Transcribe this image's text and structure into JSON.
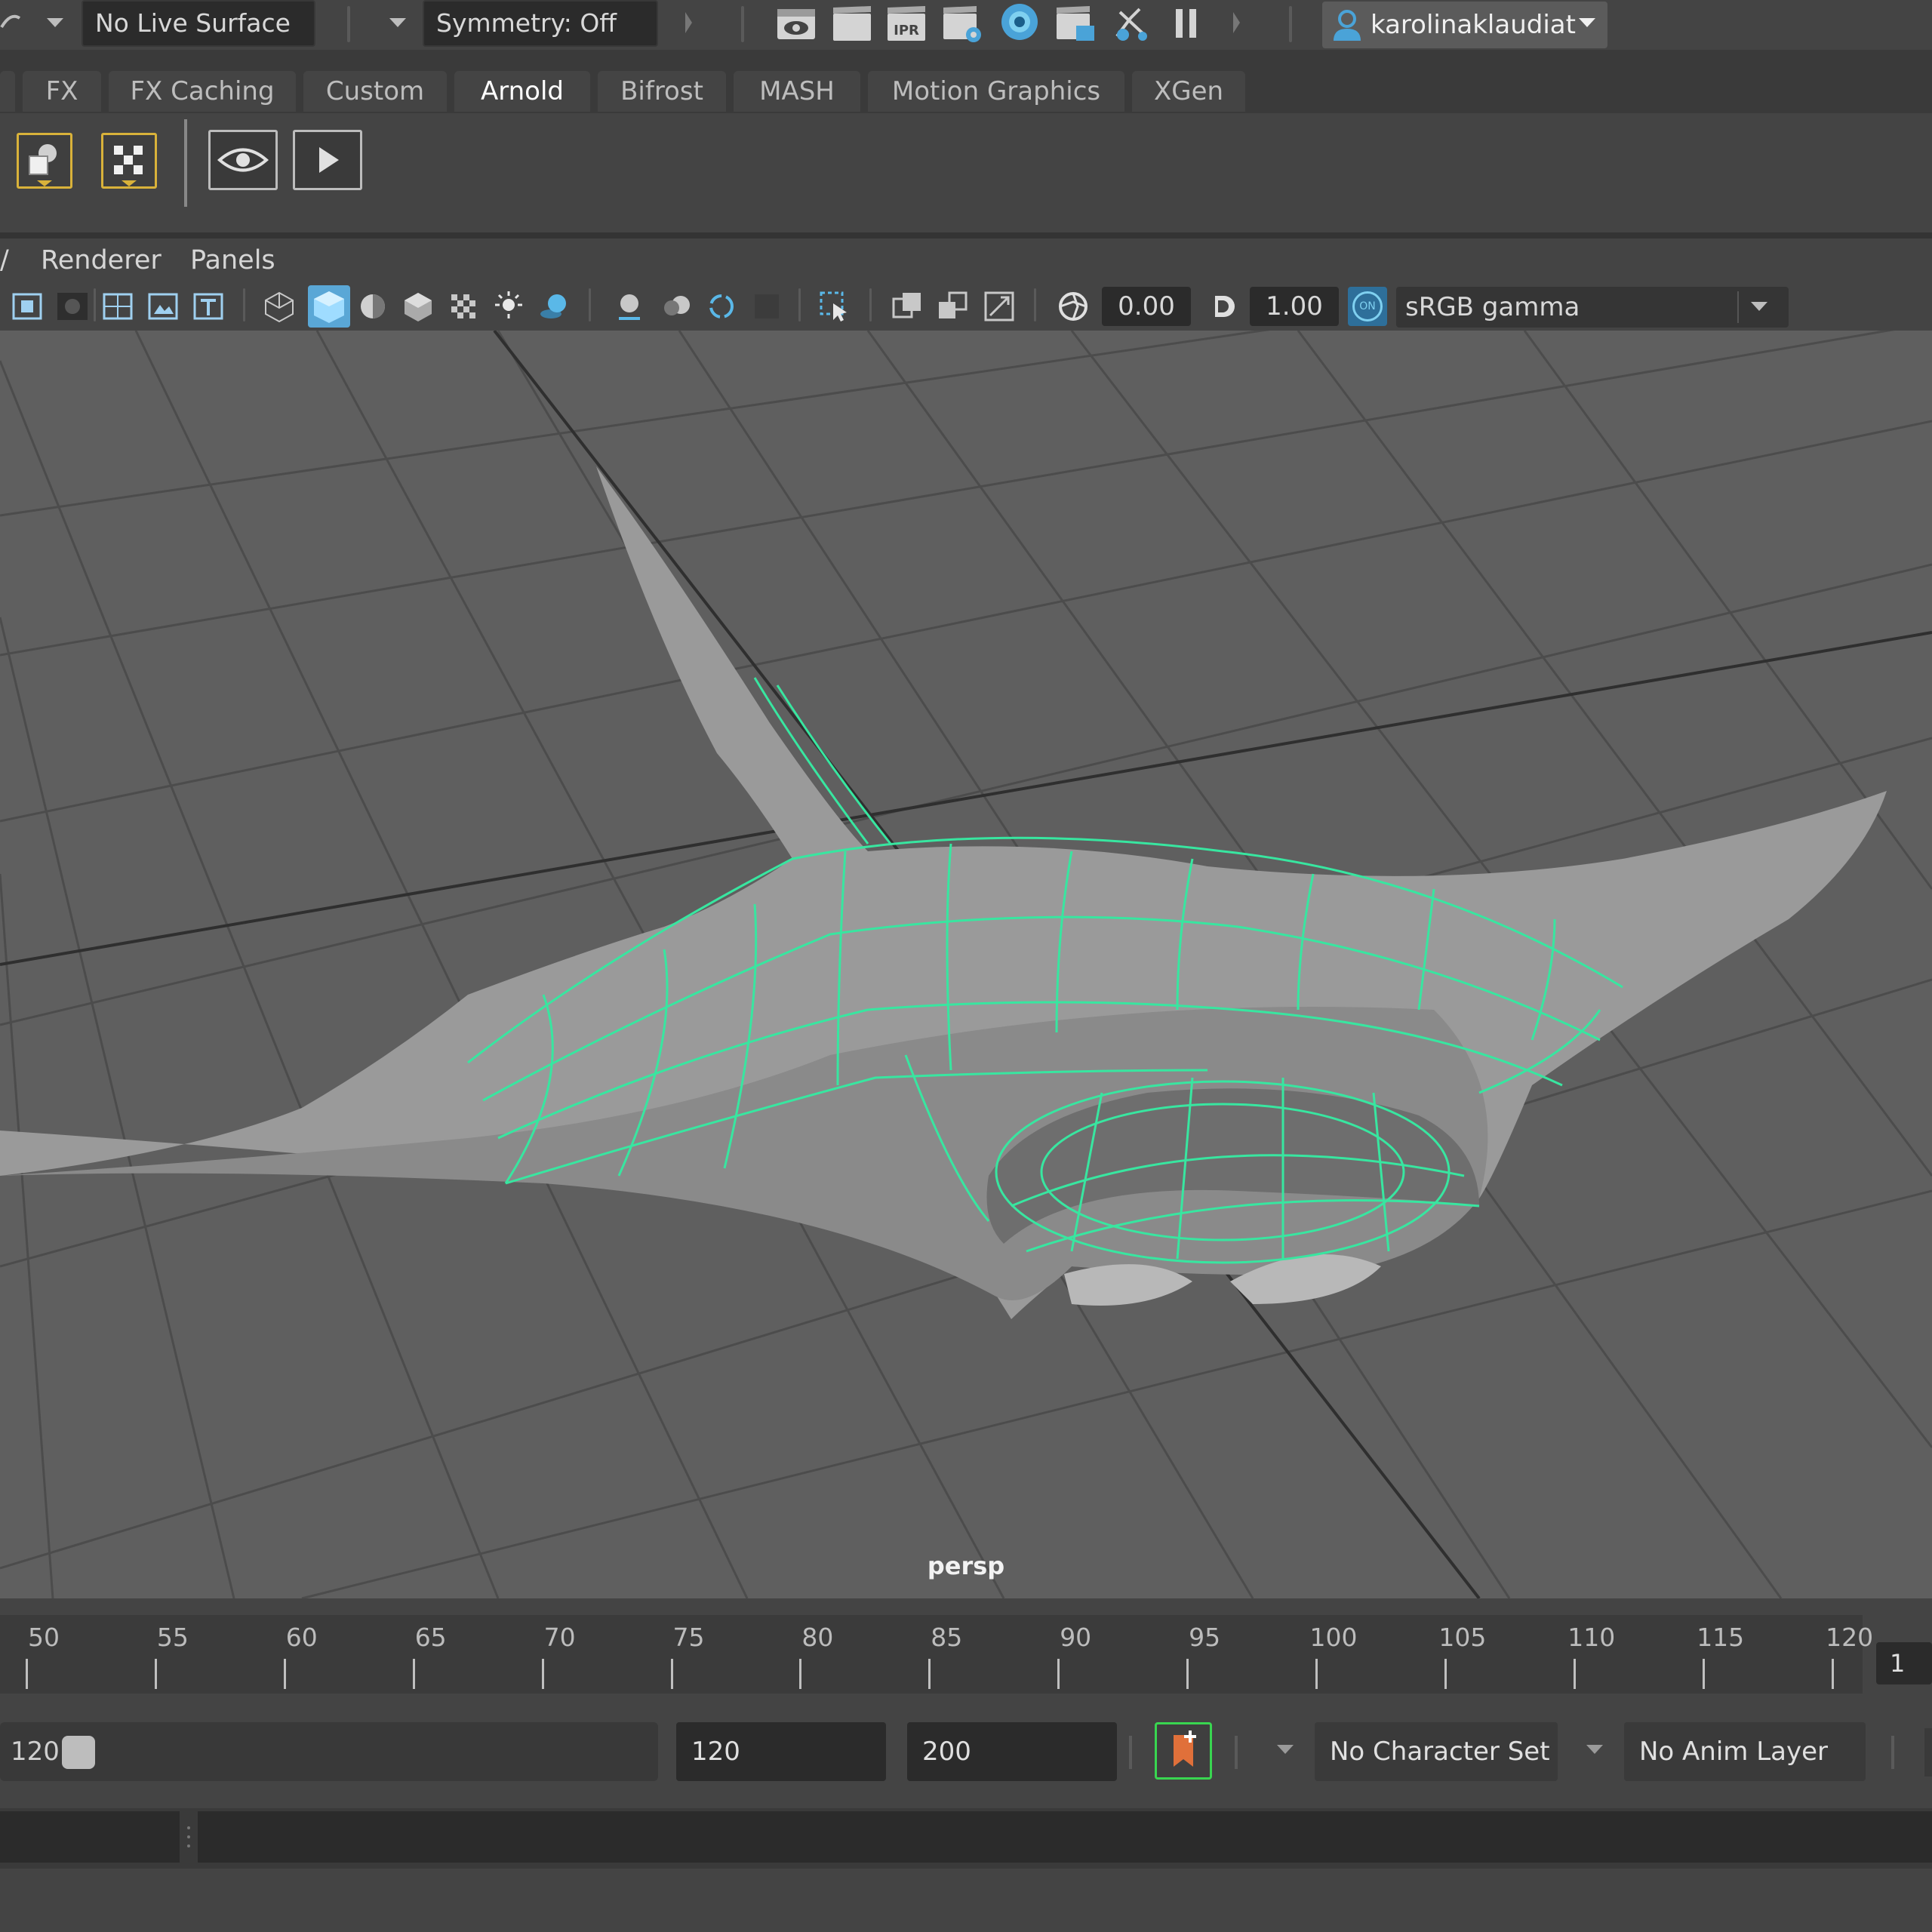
{
  "status_line": {
    "live_surface": "No Live Surface",
    "symmetry": "Symmetry: Off",
    "user": "karolinaklaudiat"
  },
  "shelf_tabs": [
    {
      "label": "FX"
    },
    {
      "label": "FX Caching"
    },
    {
      "label": "Custom"
    },
    {
      "label": "Arnold",
      "active": true
    },
    {
      "label": "Bifrost"
    },
    {
      "label": "MASH"
    },
    {
      "label": "Motion Graphics"
    },
    {
      "label": "XGen"
    }
  ],
  "panel_menu": {
    "items": [
      "Renderer",
      "Panels"
    ]
  },
  "panel_toolbar": {
    "exposure": "0.00",
    "gamma": "1.00",
    "color_space": "sRGB gamma",
    "color_mgmt_badge": "ON"
  },
  "viewport": {
    "camera": "persp"
  },
  "timeline": {
    "ticks": [
      "50",
      "55",
      "60",
      "65",
      "70",
      "75",
      "80",
      "85",
      "90",
      "95",
      "100",
      "105",
      "110",
      "115",
      "120"
    ],
    "current_frame": "1"
  },
  "range": {
    "range_end": "120",
    "anim_end": "120",
    "playback_end": "200",
    "character_set": "No Character Set",
    "anim_layer": "No Anim Layer"
  },
  "colors": {
    "wireframe": "#38e6a0",
    "accent": "#4aa3d8",
    "auto_key": "#39d650",
    "shelf_icon_border": "#d9b23a"
  }
}
